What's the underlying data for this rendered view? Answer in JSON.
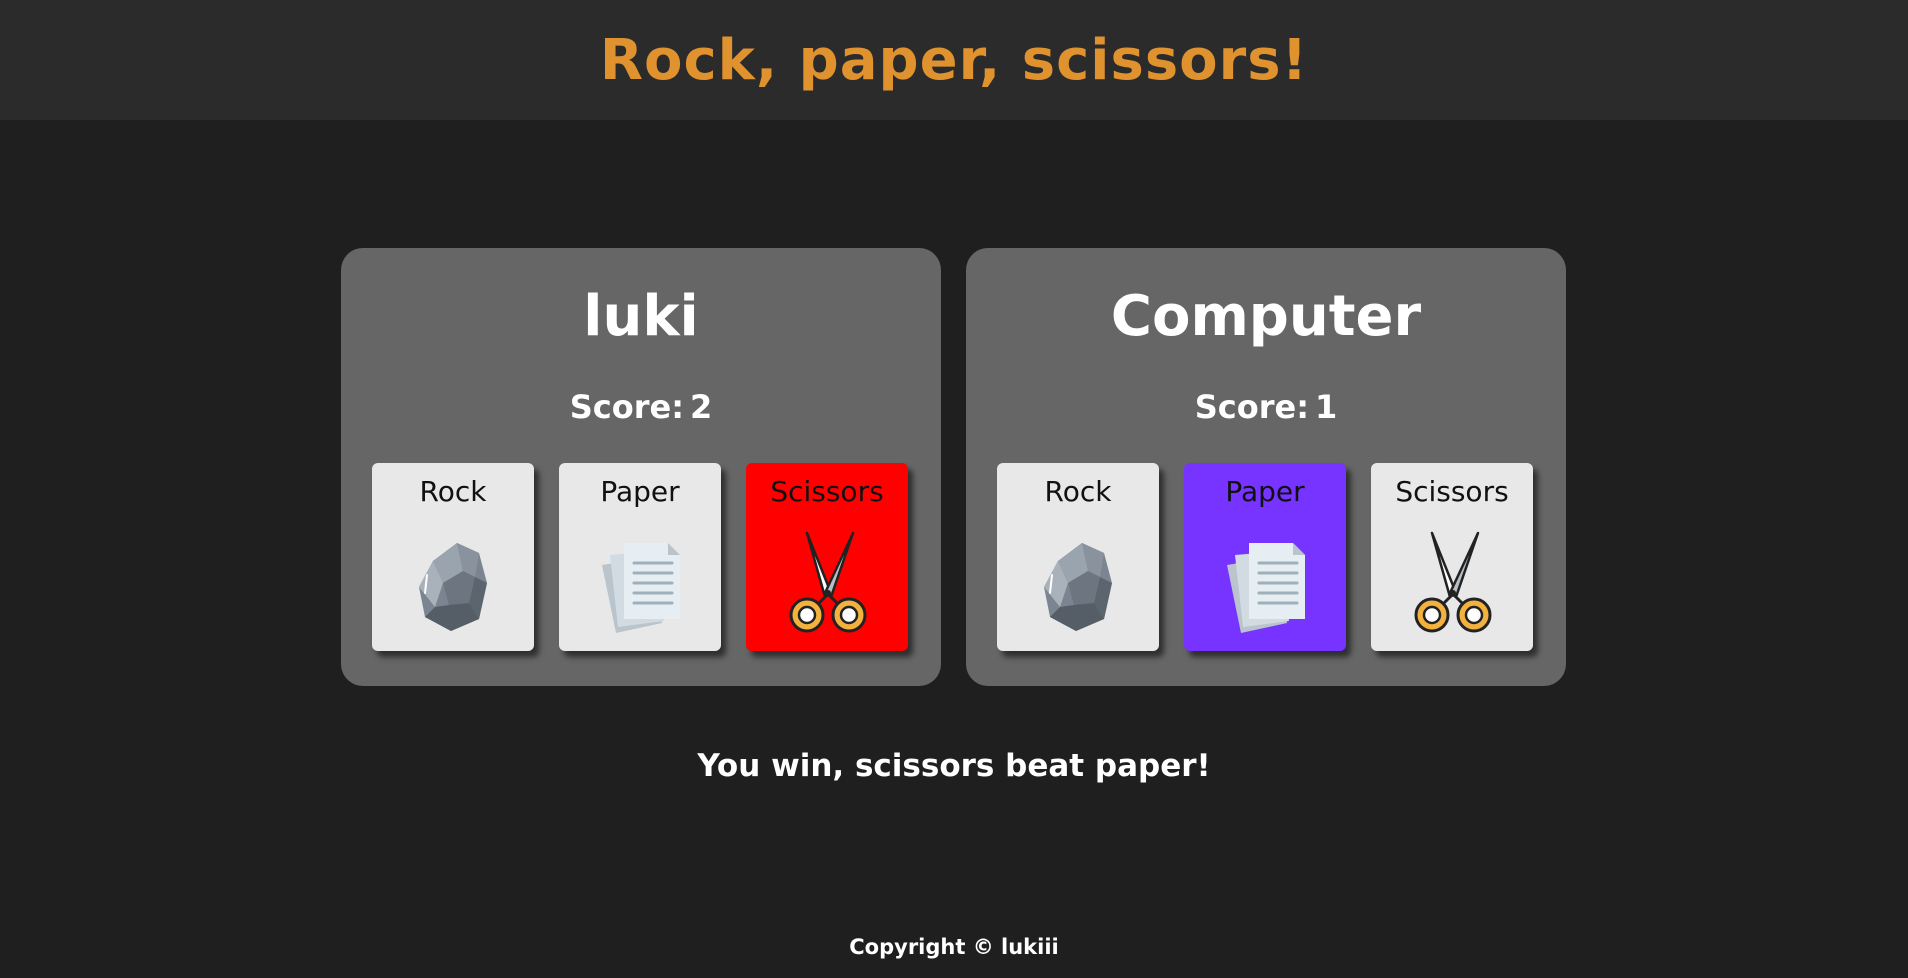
{
  "header": {
    "title": "Rock, paper, scissors!"
  },
  "players": [
    {
      "name": "luki",
      "score_label": "Score:",
      "score": "2",
      "choices": [
        {
          "label": "Rock",
          "icon": "rock-icon",
          "selected": false
        },
        {
          "label": "Paper",
          "icon": "paper-icon",
          "selected": false
        },
        {
          "label": "Scissors",
          "icon": "scissors-icon",
          "selected": true,
          "highlight": "#ff0000"
        }
      ]
    },
    {
      "name": "Computer",
      "score_label": "Score:",
      "score": "1",
      "choices": [
        {
          "label": "Rock",
          "icon": "rock-icon",
          "selected": false
        },
        {
          "label": "Paper",
          "icon": "paper-icon",
          "selected": true,
          "highlight": "#7733ff"
        },
        {
          "label": "Scissors",
          "icon": "scissors-icon",
          "selected": false
        }
      ]
    }
  ],
  "result": {
    "message": "You win, scissors beat paper!"
  },
  "footer": {
    "copyright": "Copyright © lukiii"
  },
  "colors": {
    "title": "#e0922f",
    "panel": "#666666",
    "card": "#e8e8e8",
    "player_selected": "#ff0000",
    "computer_selected": "#7733ff"
  }
}
